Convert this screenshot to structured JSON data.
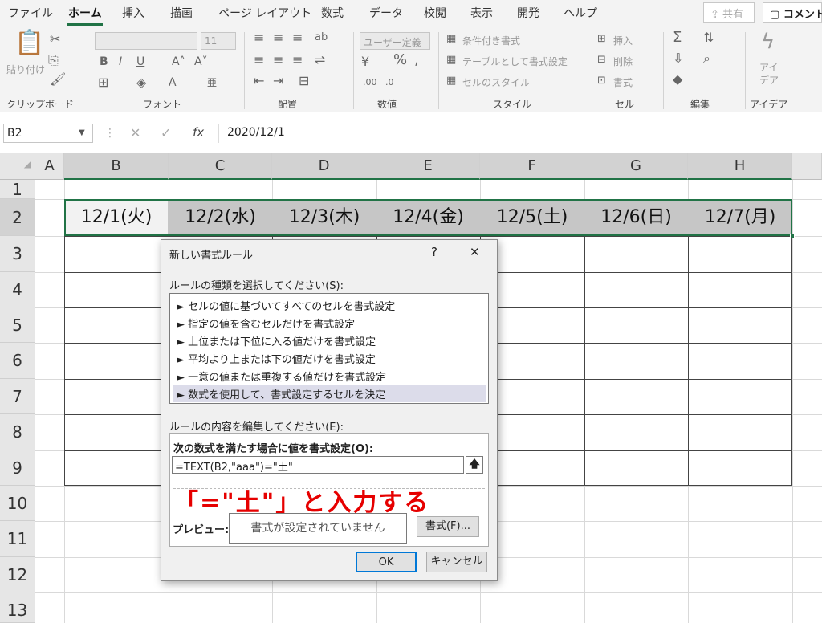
{
  "ribbon_tabs": [
    "ファイル",
    "ホーム",
    "挿入",
    "描画",
    "ページ レイアウト",
    "数式",
    "データ",
    "校閲",
    "表示",
    "開発",
    "ヘルプ"
  ],
  "share_label": "共有",
  "comment_label": "コメント",
  "clipboard": {
    "paste_label": "貼り付け",
    "group": "クリップボード"
  },
  "font": {
    "name_value": "",
    "size_value": "11",
    "group": "フォント"
  },
  "alignment": {
    "group": "配置"
  },
  "number": {
    "format_value": "ユーザー定義",
    "group": "数値"
  },
  "styles": {
    "conditional": "条件付き書式",
    "as_table": "テーブルとして書式設定",
    "cell_styles": "セルのスタイル",
    "group": "スタイル"
  },
  "cells": {
    "insert": "挿入",
    "delete": "削除",
    "format": "書式",
    "group": "セル"
  },
  "editing": {
    "group": "編集"
  },
  "ideas": {
    "label": "アイ\nデア",
    "group": "アイデア"
  },
  "formula_bar": {
    "name_box": "B2",
    "fx": "fx",
    "value": "2020/12/1"
  },
  "columns": [
    "A",
    "B",
    "C",
    "D",
    "E",
    "F",
    "G",
    "H"
  ],
  "rows": [
    "1",
    "2",
    "3",
    "4",
    "5",
    "6",
    "7",
    "8",
    "9",
    "10",
    "11",
    "12",
    "13"
  ],
  "row2_values": [
    "12/1(火)",
    "12/2(水)",
    "12/3(木)",
    "12/4(金)",
    "12/5(土)",
    "12/6(日)",
    "12/7(月)"
  ],
  "dialog": {
    "title": "新しい書式ルール",
    "help": "?",
    "close": "✕",
    "rule_type_label": "ルールの種類を選択してください(S):",
    "rule_types": [
      "► セルの値に基づいてすべてのセルを書式設定",
      "► 指定の値を含むセルだけを書式設定",
      "► 上位または下位に入る値だけを書式設定",
      "► 平均より上または下の値だけを書式設定",
      "► 一意の値または重複する値だけを書式設定",
      "► 数式を使用して、書式設定するセルを決定"
    ],
    "edit_label": "ルールの内容を編集してください(E):",
    "formula_label": "次の数式を満たす場合に値を書式設定(O):",
    "formula_value": "=TEXT(B2,\"aaa\")=\"土\"",
    "annotation": "「=\"土\"」と入力する",
    "preview_label": "プレビュー:",
    "preview_text": "書式が設定されていません",
    "format_button": "書式(F)...",
    "ok": "OK",
    "cancel": "キャンセル"
  },
  "colors": {
    "excel_green": "#217346",
    "annotation_red": "#e60000"
  }
}
